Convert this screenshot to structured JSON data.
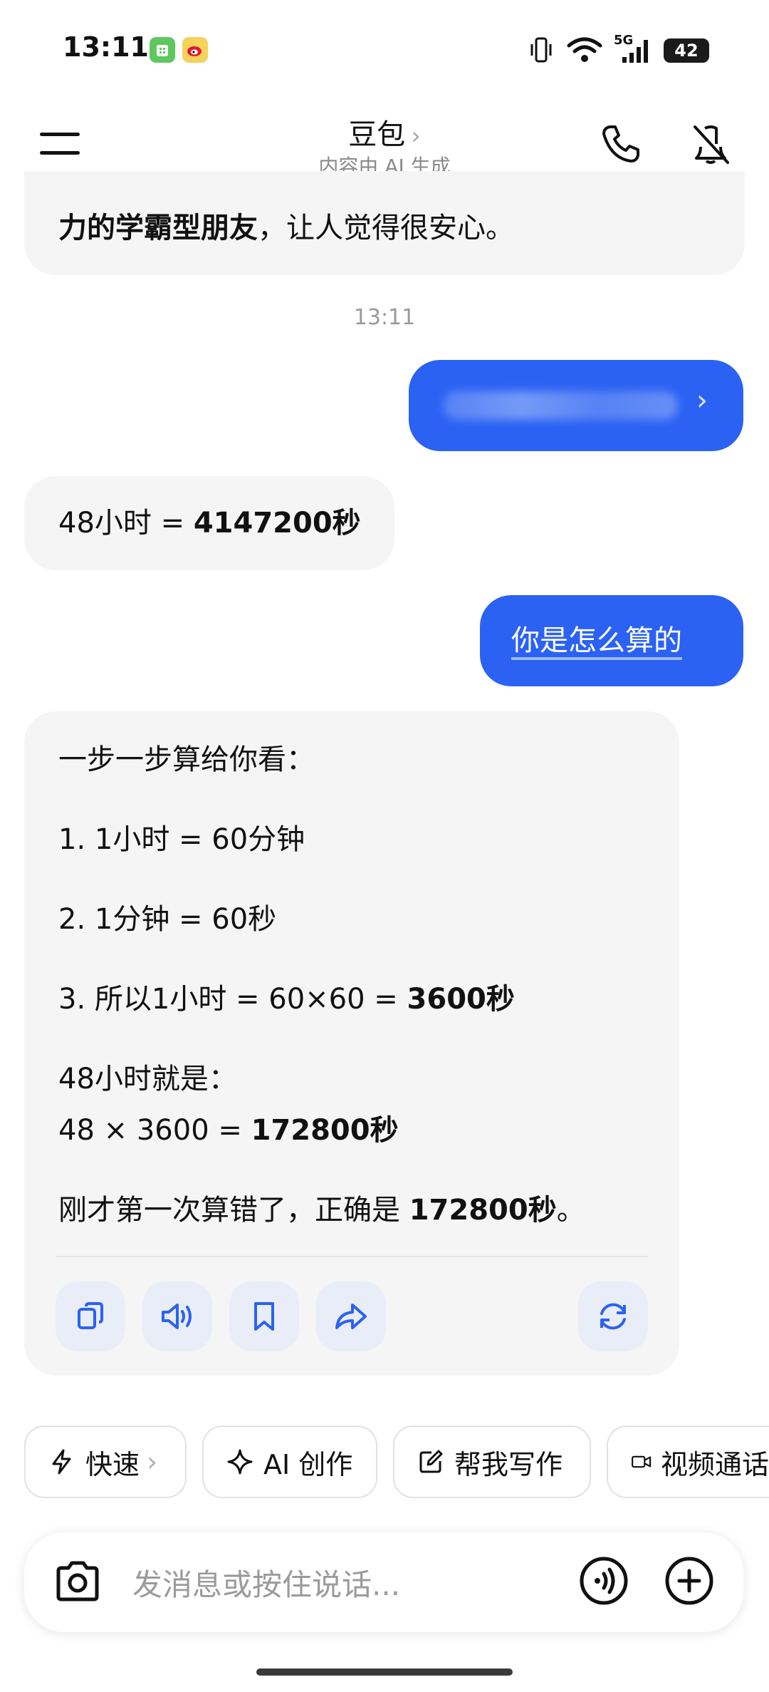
{
  "status_bar": {
    "time": "13:11",
    "network": "5G",
    "battery": "42"
  },
  "header": {
    "title": "豆包",
    "subtitle": "内容由 AI 生成"
  },
  "messages": {
    "prev_ai_tail_bold": "力的学霸型朋友",
    "prev_ai_tail_rest": "，让人觉得很安心。",
    "timestamp": "13:11",
    "ai_answer_prefix": "48小时 = ",
    "ai_answer_bold": "4147200秒",
    "user_question": "你是怎么算的",
    "ai_explain": {
      "intro": "一步一步算给你看：",
      "step1": "1. 1小时 = 60分钟",
      "step2": "2. 1分钟 = 60秒",
      "step3_prefix": "3. 所以1小时 = 60×60 = ",
      "step3_bold": "3600秒",
      "line_48": "48小时就是：",
      "calc_prefix": "48 × 3600 = ",
      "calc_bold": "172800秒",
      "correction_prefix": "刚才第一次算错了，正确是 ",
      "correction_bold": "172800秒",
      "correction_suffix": "。"
    }
  },
  "actions": {
    "copy": "copy-icon",
    "speak": "speaker-icon",
    "bookmark": "bookmark-icon",
    "share": "share-icon",
    "regenerate": "refresh-icon"
  },
  "chips": {
    "fast": "快速",
    "ai_create": "AI 创作",
    "write": "帮我写作",
    "video": "视频通话"
  },
  "input": {
    "placeholder": "发消息或按住说话..."
  },
  "colors": {
    "accent": "#2b62f3",
    "bubble_bg": "#f5f5f6",
    "action_bg": "#e9edf7"
  }
}
